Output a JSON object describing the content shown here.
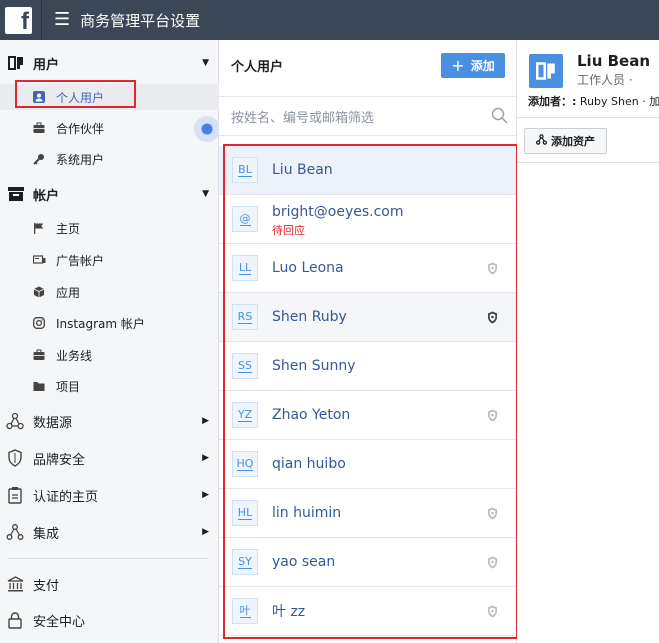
{
  "topbar": {
    "logo": "f",
    "title": "商务管理平台设置"
  },
  "sidebar": {
    "users_section": {
      "label": "用户"
    },
    "users_items": [
      {
        "label": "个人用户",
        "icon": "person-icon"
      },
      {
        "label": "合作伙伴",
        "icon": "briefcase-icon"
      },
      {
        "label": "系统用户",
        "icon": "key-icon"
      }
    ],
    "accounts_section": {
      "label": "帐户"
    },
    "accounts_items": [
      {
        "label": "主页",
        "icon": "flag-icon"
      },
      {
        "label": "广告帐户",
        "icon": "ad-account-icon"
      },
      {
        "label": "应用",
        "icon": "cube-icon"
      },
      {
        "label": "Instagram 帐户",
        "icon": "instagram-icon"
      },
      {
        "label": "业务线",
        "icon": "briefcase-icon"
      },
      {
        "label": "项目",
        "icon": "folder-icon"
      }
    ],
    "nav_items": [
      {
        "label": "数据源",
        "icon": "data-source-icon"
      },
      {
        "label": "品牌安全",
        "icon": "shield-icon"
      },
      {
        "label": "认证的主页",
        "icon": "clipboard-icon"
      },
      {
        "label": "集成",
        "icon": "integration-icon"
      }
    ],
    "bottom_items": [
      {
        "label": "支付",
        "icon": "bank-icon"
      },
      {
        "label": "安全中心",
        "icon": "lock-icon"
      }
    ]
  },
  "list": {
    "title": "个人用户",
    "add_label": "添加",
    "search_placeholder": "按姓名、编号或邮箱筛选",
    "users": [
      {
        "initials": "BL",
        "name": "Liu Bean",
        "status": "",
        "shield": "none"
      },
      {
        "initials": "@",
        "name": "bright@oeyes.com",
        "status": "待回应",
        "shield": "none"
      },
      {
        "initials": "LL",
        "name": "Luo Leona",
        "status": "",
        "shield": "light"
      },
      {
        "initials": "RS",
        "name": "Shen Ruby",
        "status": "",
        "shield": "dark"
      },
      {
        "initials": "SS",
        "name": "Shen Sunny",
        "status": "",
        "shield": "none"
      },
      {
        "initials": "YZ",
        "name": "Zhao Yeton",
        "status": "",
        "shield": "light"
      },
      {
        "initials": "HQ",
        "name": "qian huibo",
        "status": "",
        "shield": "none"
      },
      {
        "initials": "HL",
        "name": "lin huimin",
        "status": "",
        "shield": "light"
      },
      {
        "initials": "SY",
        "name": "yao sean",
        "status": "",
        "shield": "light"
      },
      {
        "initials": "叶",
        "name": "叶 zz",
        "status": "",
        "shield": "light"
      }
    ]
  },
  "detail": {
    "name": "Liu Bean",
    "role": "工作人员 ·",
    "added_by_label": "添加者：:",
    "added_by_value": "Ruby Shen · 加",
    "add_asset_label": "添加资产"
  },
  "colors": {
    "topbar": "#3b4656",
    "accent": "#4a90e2",
    "highlight_box": "#e0262f"
  }
}
